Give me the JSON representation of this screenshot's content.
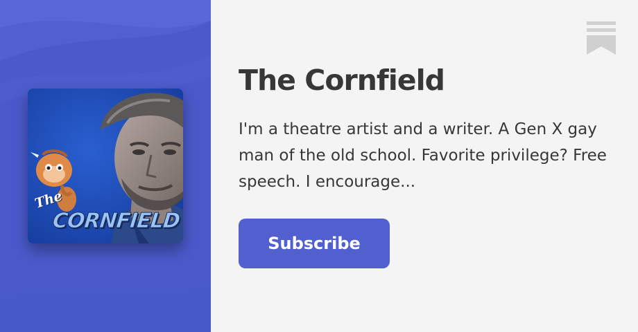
{
  "publication": {
    "title": "The Cornfield",
    "description": "I'm a theatre artist and a writer. A Gen X gay man of the old school. Favorite privilege? Free speech. I encourage...",
    "subscribe_label": "Subscribe"
  },
  "cover": {
    "title_small": "The",
    "title_big": "CORNFIELD"
  },
  "icons": {
    "bookmark": "bookmark-icon"
  },
  "colors": {
    "accent": "#5160ce",
    "left_panel": "#4a5acb",
    "background": "#f4f4f4",
    "text": "#363737",
    "bookmark": "#d0d0d0"
  }
}
